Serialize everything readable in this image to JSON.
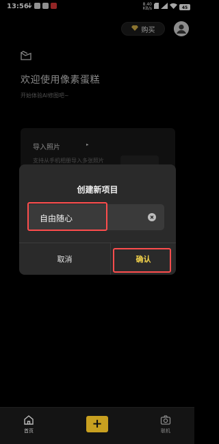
{
  "status_bar": {
    "time": "13:56",
    "network_speed_top": "8.40",
    "network_speed_bottom": "KB/s",
    "battery": "45"
  },
  "header": {
    "buy_label": "购买"
  },
  "welcome": {
    "title": "欢迎使用像素蛋糕",
    "subtitle": "开始体验AI修图吧~"
  },
  "import_card": {
    "title": "导入照片",
    "arrow": "▸",
    "description": "支持从手机相册导入多张照片"
  },
  "dialog": {
    "title": "创建新项目",
    "input_value": "自由随心",
    "cancel_label": "取消",
    "confirm_label": "确认"
  },
  "bottom_nav": {
    "home_label": "首页",
    "add_glyph": "+",
    "camera_label": "联机"
  },
  "colors": {
    "accent": "#c8a020",
    "confirm_text": "#f3d34b",
    "highlight": "#ff4d4d"
  },
  "icons": [
    "download-icon",
    "app-icon",
    "gem-icon",
    "avatar-icon",
    "logo-icon",
    "clear-icon",
    "home-icon",
    "plus-icon",
    "camera-icon"
  ]
}
